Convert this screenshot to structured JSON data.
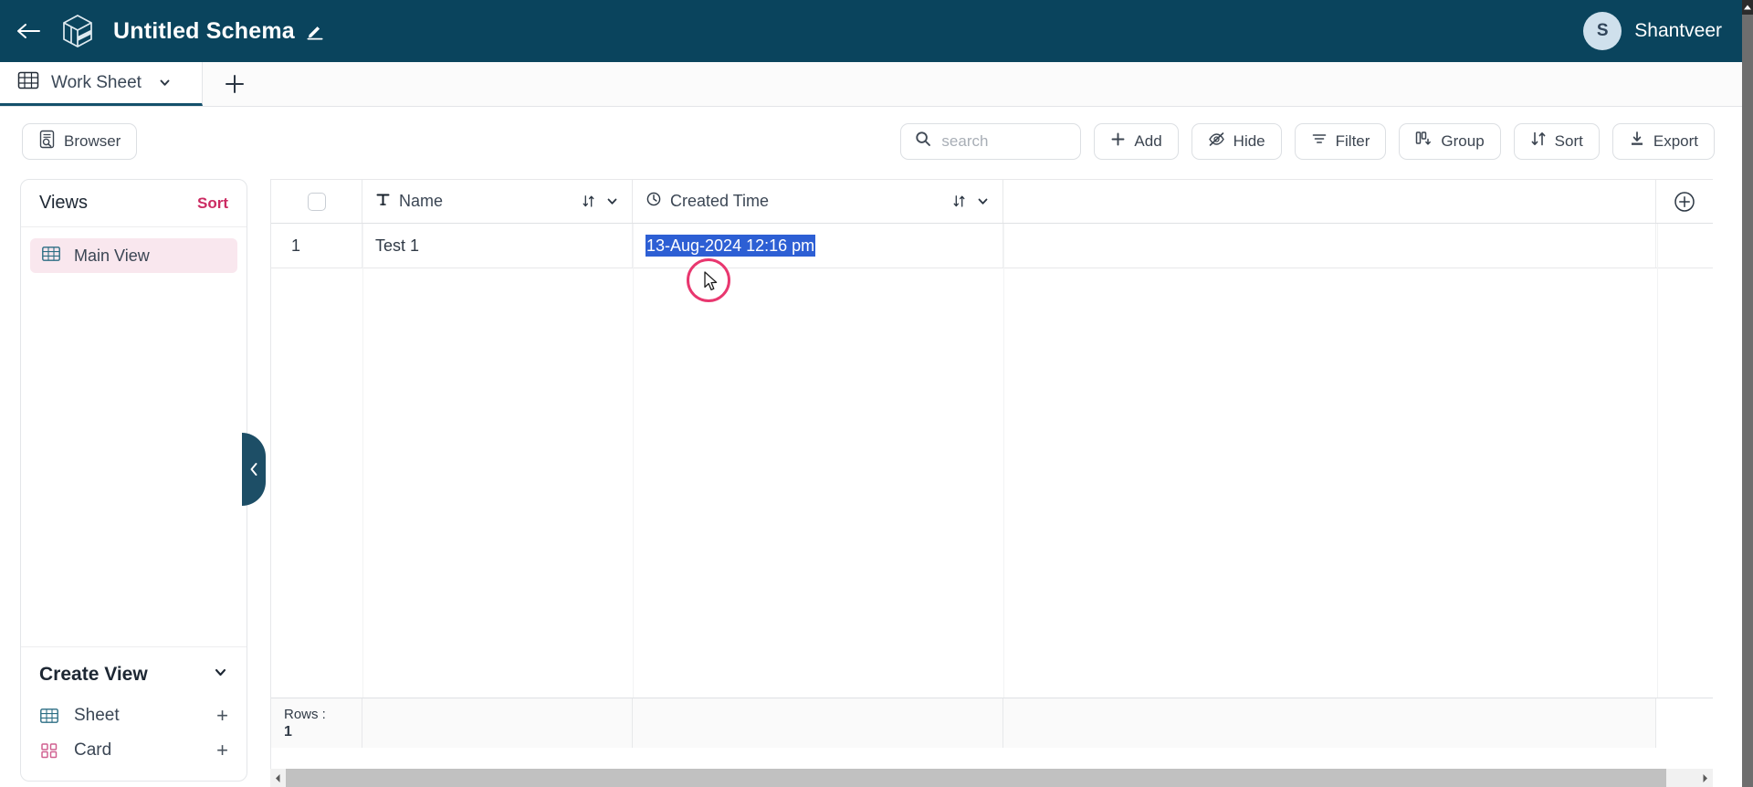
{
  "topbar": {
    "back_icon": "back-arrow-icon",
    "logo_icon": "cube-logo-icon",
    "title": "Untitled Schema",
    "edit_icon": "pencil-icon",
    "user": {
      "initial": "S",
      "name": "Shantveer"
    },
    "bg_color": "#0a445d"
  },
  "tabbar": {
    "tabs": [
      {
        "label": "Work Sheet",
        "icon": "grid-table-icon",
        "caret": "chevron-down-icon",
        "active": true
      }
    ],
    "add_tab_icon": "plus-icon"
  },
  "toolbar": {
    "browser_label": "Browser",
    "browser_icon": "document-search-icon",
    "search": {
      "placeholder": "search",
      "value": "",
      "icon": "search-icon"
    },
    "buttons": [
      {
        "label": "Add",
        "icon": "plus-icon"
      },
      {
        "label": "Hide",
        "icon": "eye-off-icon"
      },
      {
        "label": "Filter",
        "icon": "filter-icon"
      },
      {
        "label": "Group",
        "icon": "group-icon"
      },
      {
        "label": "Sort",
        "icon": "sort-arrows-icon"
      },
      {
        "label": "Export",
        "icon": "download-icon"
      }
    ]
  },
  "sidebar": {
    "views_title": "Views",
    "views_sort_label": "Sort",
    "views": [
      {
        "label": "Main View",
        "icon": "grid-table-icon",
        "active": true
      }
    ],
    "create_view": {
      "title": "Create View",
      "caret": "chevron-down-icon",
      "items": [
        {
          "label": "Sheet",
          "icon": "grid-table-icon",
          "add_icon": "plus-icon"
        },
        {
          "label": "Card",
          "icon": "card-squares-icon",
          "add_icon": "plus-icon"
        }
      ]
    },
    "accent_color": "#cc2c63",
    "active_bg": "#f9e7ee"
  },
  "collapse_handle": {
    "icon": "chevron-left-icon"
  },
  "grid": {
    "select_all_checkbox": false,
    "columns": [
      {
        "label": "Name",
        "type_icon": "text-type-icon",
        "sort_icon": "sort-arrows-icon",
        "caret": "chevron-down-icon"
      },
      {
        "label": "Created Time",
        "type_icon": "clock-icon",
        "sort_icon": "sort-arrows-icon",
        "caret": "chevron-down-icon"
      }
    ],
    "add_column_icon": "circle-plus-icon",
    "rows": [
      {
        "num": "1",
        "name": "Test 1",
        "created_time": "13-Aug-2024 12:16 pm",
        "created_time_selected": true
      }
    ],
    "footer": {
      "rows_label": "Rows :",
      "rows_count": "1"
    },
    "selection_color": "#2d5fd4"
  },
  "scrollbars": {
    "horizontal": {
      "left_arrow": "chevron-left-icon",
      "right_arrow": "chevron-right-icon"
    },
    "vertical": {
      "up_arrow": "chevron-up-icon"
    }
  },
  "cursor": {
    "click_indicator": "click-ring",
    "pointer": "arrow-cursor"
  }
}
